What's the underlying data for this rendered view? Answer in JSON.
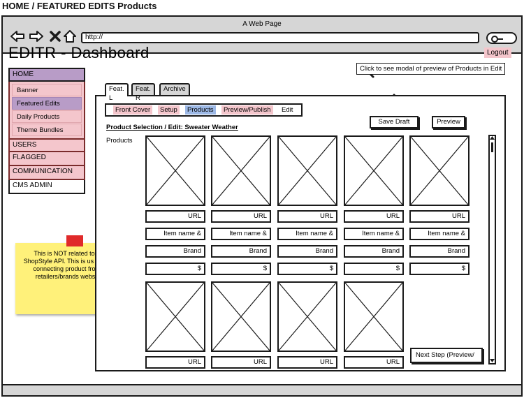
{
  "page_title": "HOME / FEATURED EDITS Products",
  "browser": {
    "window_title": "A Web Page",
    "url": "http://"
  },
  "app_title": "EDITR - Dashboard",
  "logout_label": "Logout",
  "tooltip": "Click to see modal of preview of Products in Edit",
  "sidebar": {
    "home": "HOME",
    "sub_items": [
      {
        "label": "Banner"
      },
      {
        "label": "Featured Edits"
      },
      {
        "label": "Daily Products"
      },
      {
        "label": "Theme Bundles"
      }
    ],
    "users": "USERS",
    "flagged": "FLAGGED",
    "communication": "COMMUNICATION",
    "cms_admin": "CMS ADMIN"
  },
  "sticky_note": "This is NOT related to the ShopStyle API. This is us directly connecting product from a retailers/brands website.",
  "tabs": [
    {
      "label": "Feat. L"
    },
    {
      "label": "Feat. R"
    },
    {
      "label": "Archive"
    }
  ],
  "subnav": {
    "front_cover": "Front Cover",
    "setup": "Setup",
    "products": "Products",
    "preview_publish": "Preview/Publish",
    "edit": "Edit"
  },
  "section_title": "Product Selection / Edit: Sweater Weather",
  "products_label": "Products",
  "buttons": {
    "save_draft": "Save Draft",
    "preview": "Preview",
    "next_step": "Next Step (Preview/"
  },
  "card_fields": {
    "url": "URL",
    "item_name": "Item name &",
    "brand": "Brand",
    "price": "$"
  },
  "colors": {
    "accent_purple": "#b89cc7",
    "pink": "#f4c6cc",
    "blue": "#9db9e6",
    "sticky_yellow": "#fff17a",
    "tape_red": "#e02a2a"
  }
}
